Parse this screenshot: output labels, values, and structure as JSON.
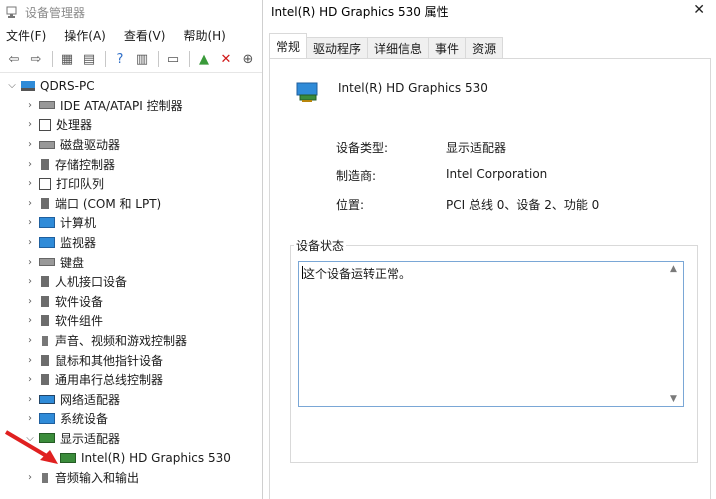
{
  "devmgr": {
    "title": "设备管理器",
    "menu": [
      "文件(F)",
      "操作(A)",
      "查看(V)",
      "帮助(H)"
    ],
    "tree": {
      "root": "QDRS-PC",
      "items": [
        {
          "label": "IDE ATA/ATAPI 控制器",
          "icon": "ide-controller-icon"
        },
        {
          "label": "处理器",
          "icon": "processor-icon"
        },
        {
          "label": "磁盘驱动器",
          "icon": "disk-drive-icon"
        },
        {
          "label": "存储控制器",
          "icon": "storage-controller-icon"
        },
        {
          "label": "打印队列",
          "icon": "print-queue-icon"
        },
        {
          "label": "端口 (COM 和 LPT)",
          "icon": "port-icon"
        },
        {
          "label": "计算机",
          "icon": "computer-icon"
        },
        {
          "label": "监视器",
          "icon": "monitor-icon"
        },
        {
          "label": "键盘",
          "icon": "keyboard-icon"
        },
        {
          "label": "人机接口设备",
          "icon": "hid-icon"
        },
        {
          "label": "软件设备",
          "icon": "software-device-icon"
        },
        {
          "label": "软件组件",
          "icon": "software-component-icon"
        },
        {
          "label": "声音、视频和游戏控制器",
          "icon": "audio-video-icon"
        },
        {
          "label": "鼠标和其他指针设备",
          "icon": "mouse-icon"
        },
        {
          "label": "通用串行总线控制器",
          "icon": "usb-controller-icon"
        },
        {
          "label": "网络适配器",
          "icon": "network-adapter-icon"
        },
        {
          "label": "系统设备",
          "icon": "system-device-icon"
        },
        {
          "label": "显示适配器",
          "icon": "display-adapter-icon"
        }
      ],
      "child": "Intel(R) HD Graphics 530",
      "last": "音频输入和输出"
    }
  },
  "dialog": {
    "title": "Intel(R) HD Graphics 530 属性",
    "tabs": [
      "常规",
      "驱动程序",
      "详细信息",
      "事件",
      "资源"
    ],
    "device_name": "Intel(R) HD Graphics 530",
    "props": [
      {
        "label": "设备类型:",
        "value": "显示适配器"
      },
      {
        "label": "制造商:",
        "value": "Intel Corporation"
      },
      {
        "label": "位置:",
        "value": "PCI 总线 0、设备 2、功能 0"
      }
    ],
    "status_label": "设备状态",
    "status_text": "这个设备运转正常。"
  },
  "colors": {
    "accent": "#2f8bd8",
    "arrow": "#e02020"
  }
}
